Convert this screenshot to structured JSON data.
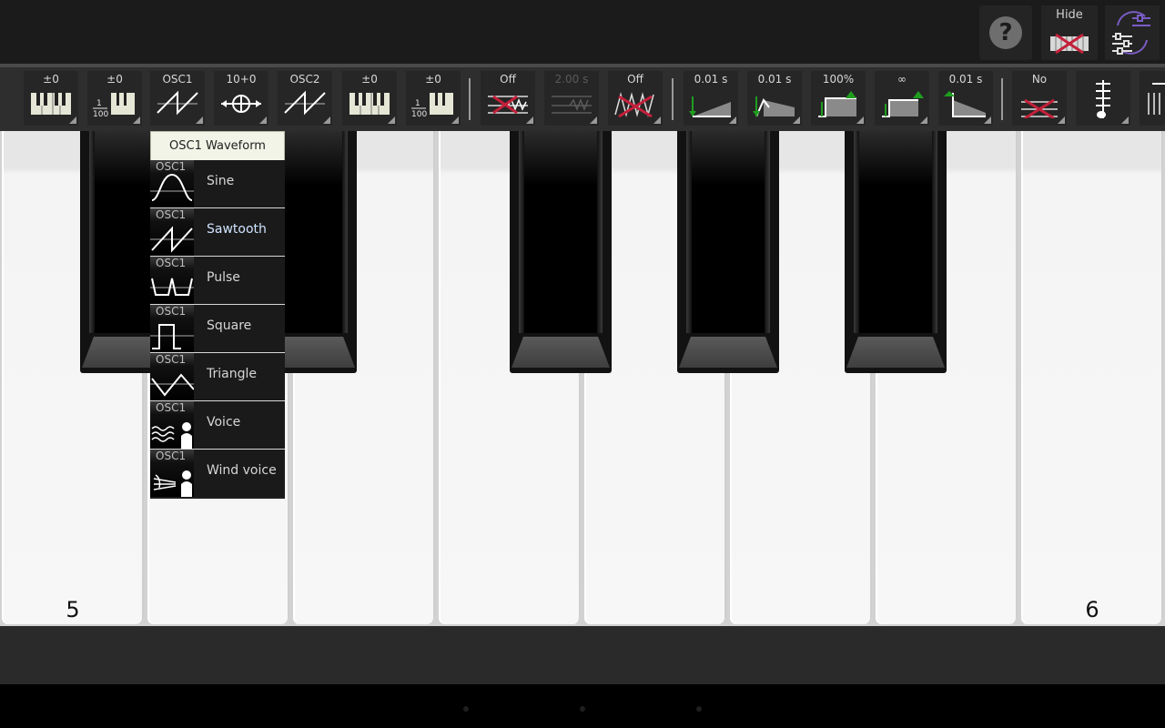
{
  "topbar": {
    "help_label": "?",
    "hide_label": "Hide"
  },
  "toolbar": {
    "buttons": [
      {
        "label": "±0",
        "icon": "keyboard-transpose-icon"
      },
      {
        "label": "±0",
        "icon": "fine-tune-icon"
      },
      {
        "label": "OSC1",
        "icon": "sawtooth-wave-icon"
      },
      {
        "label": "10+0",
        "icon": "osc-mix-icon"
      },
      {
        "label": "OSC2",
        "icon": "sawtooth-wave-icon"
      },
      {
        "label": "±0",
        "icon": "keyboard-transpose-icon"
      },
      {
        "label": "±0",
        "icon": "fine-tune-icon"
      },
      {
        "label": "Off",
        "icon": "lfo-off-icon"
      },
      {
        "label": "2.00 s",
        "icon": "lfo-rate-icon"
      },
      {
        "label": "Off",
        "icon": "filter-off-icon"
      },
      {
        "label": "0.01 s",
        "icon": "attack-envelope-icon"
      },
      {
        "label": "0.01 s",
        "icon": "decay-envelope-icon"
      },
      {
        "label": "100%",
        "icon": "sustain-level-icon"
      },
      {
        "label": "∞",
        "icon": "sustain-time-icon"
      },
      {
        "label": "0.01 s",
        "icon": "release-envelope-icon"
      },
      {
        "label": "No",
        "icon": "effect-off-icon"
      },
      {
        "label": "",
        "icon": "slider-icon"
      },
      {
        "label": "",
        "icon": "mixer-icon"
      }
    ]
  },
  "keyboard": {
    "octave_labels": [
      "5",
      "6"
    ]
  },
  "dropdown": {
    "title": "OSC1 Waveform",
    "tag": "OSC1",
    "selected": "Sawtooth",
    "items": [
      {
        "name": "Sine",
        "icon": "sine-wave-icon"
      },
      {
        "name": "Sawtooth",
        "icon": "sawtooth-wave-icon"
      },
      {
        "name": "Pulse",
        "icon": "pulse-wave-icon"
      },
      {
        "name": "Square",
        "icon": "square-wave-icon"
      },
      {
        "name": "Triangle",
        "icon": "triangle-wave-icon"
      },
      {
        "name": "Voice",
        "icon": "voice-icon"
      },
      {
        "name": "Wind voice",
        "icon": "wind-voice-icon"
      }
    ]
  },
  "colors": {
    "accent_green": "#1f9e1f",
    "accent_red": "#c3203a",
    "accent_purple": "#7a5cc4"
  }
}
